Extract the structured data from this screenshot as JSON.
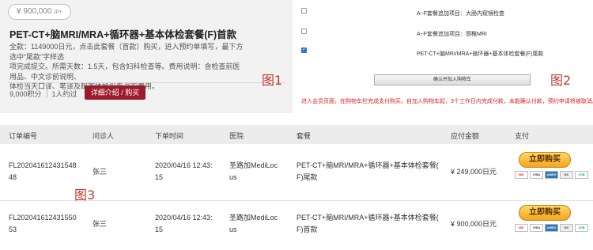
{
  "product": {
    "price": "¥ 900,000",
    "price_unit": "JPY",
    "title": "PET-CT+脑MRI/MRA+循环器+基本体检套餐(F)首款",
    "desc_lines": [
      "全款：1149000日元，点击此套餐（首款）购买，进入预约单填写，最下方选中“尾款”字样选",
      "项完成提交。所需天数：1.5天，包含妇科检查等。费用说明：含检查前医用品、中文诊前说明、",
      "体检当天口译、笔译及邮寄体检报告书的费用。"
    ],
    "points": "9,000积分",
    "people": "1人约过",
    "detail_button": "详细介绍 / 购买"
  },
  "labels": {
    "fig1": "图1",
    "fig2": "图2",
    "fig3": "图3"
  },
  "options": {
    "items": [
      {
        "prefix": "A~F套餐追加项目：大肠内窥镜检查",
        "checked": false
      },
      {
        "prefix": "A~F套餐追加项目：颈椎MRI",
        "checked": false
      },
      {
        "prefix": "PET-CT+脑MRI/MRA+循环器+基本体检套餐(F)尾款",
        "checked": true
      }
    ],
    "cart_button": "确认并加入购物车",
    "note": "进入会员页面，在购物车栏完成支付购买。自加入购物车起，3个工作日内完成付款，未能确认付款，预约申请将被取消。"
  },
  "table": {
    "headers": [
      "订单编号",
      "问诊人",
      "下单时间",
      "医院",
      "套餐",
      "应付金额",
      "支付"
    ],
    "rows": [
      {
        "order_line1": "FL202041612431548",
        "order_line2": "48",
        "patient": "张三",
        "time_line1": "2020/04/16 12:43:",
        "time_line2": "15",
        "hospital_line1": "圣路加MediLoc",
        "hospital_line2": "us",
        "package_line1": "PET-CT+脑MRI/MRA+循环器+基本体检套餐(",
        "package_line2": "F)尾款",
        "amount": "¥ 249,000日元",
        "pay_button": "立即购买"
      },
      {
        "order_line1": "FL202041612431550",
        "order_line2": "53",
        "patient": "张三",
        "time_line1": "2020/04/16 12:43:",
        "time_line2": "15",
        "hospital_line1": "圣路加MediLoc",
        "hospital_line2": "us",
        "package_line1": "PET-CT+脑MRI/MRA+循环器+基本体检套餐(",
        "package_line2": "F)首款",
        "amount": "¥ 900,000日元",
        "pay_button": "立即购买"
      }
    ]
  },
  "colors": {
    "accent": "#9b1b2a",
    "label_red": "#c0392b",
    "buy_button": "#f4a61d"
  },
  "icons": [
    "checkbox",
    "mastercard-icon",
    "visa-icon",
    "amex-icon",
    "diners-icon",
    "jcb-icon"
  ]
}
